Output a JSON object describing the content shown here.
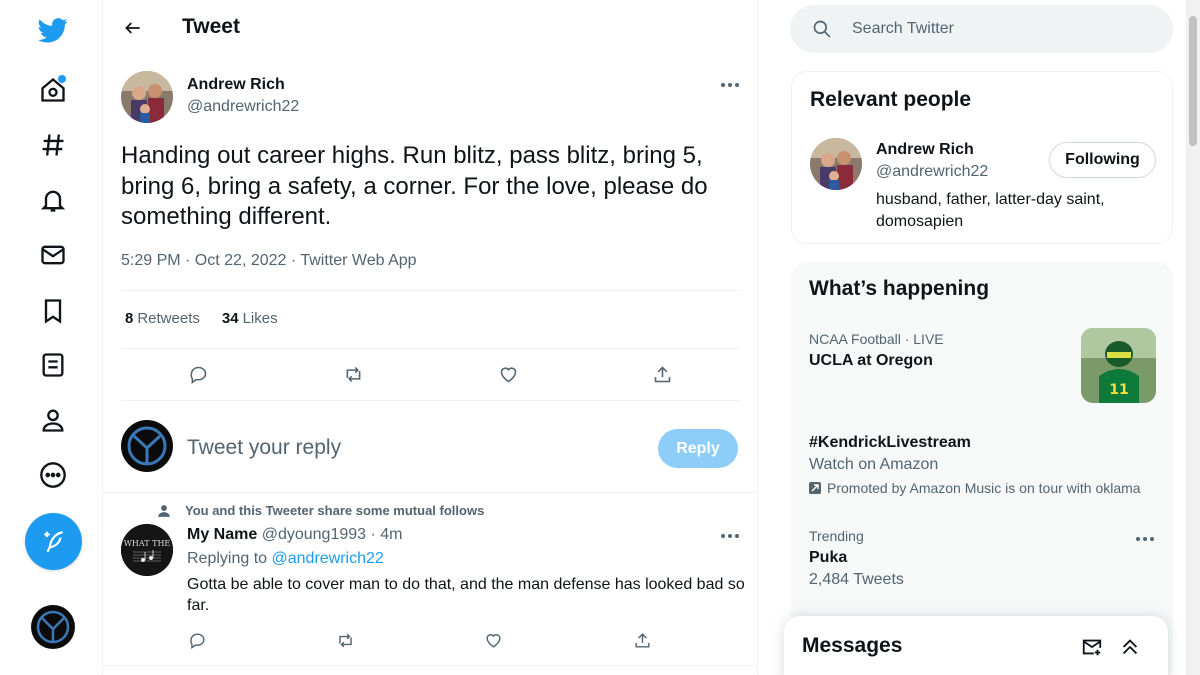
{
  "header": {
    "title": "Tweet"
  },
  "tweet": {
    "author_name": "Andrew Rich",
    "author_handle": "@andrewrich22",
    "text": "Handing out career highs. Run blitz, pass blitz, bring 5, bring 6, bring a safety, a corner. For the love, please do something different.",
    "meta": "5:29 PM · Oct 22, 2022 · Twitter Web App",
    "retweets_count": "8",
    "retweets_label": "Retweets",
    "likes_count": "34",
    "likes_label": "Likes"
  },
  "reply_box": {
    "placeholder": "Tweet your reply",
    "button_label": "Reply"
  },
  "reply": {
    "social_context": "You and this Tweeter share some mutual follows",
    "name": "My Name",
    "handle": "@dyoung1993",
    "time": "· 4m",
    "replying_prefix": "Replying to",
    "replying_to": "@andrewrich22",
    "text": "Gotta be able to cover man to do that, and the man defense has looked bad so far.",
    "avatar_text": "WHAT THE"
  },
  "search": {
    "placeholder": "Search Twitter"
  },
  "relevant_people": {
    "title": "Relevant people",
    "name": "Andrew Rich",
    "handle": "@andrewrich22",
    "bio": "husband, father, latter-day saint, domosapien",
    "button": "Following"
  },
  "whats_happening": {
    "title": "What’s happening",
    "trends": [
      {
        "category": "NCAA Football · LIVE",
        "title": "UCLA at Oregon"
      },
      {
        "title": "#KendrickLivestream",
        "subtitle": "Watch on Amazon",
        "promo": "Promoted by Amazon Music is on tour with oklama"
      },
      {
        "category": "Trending",
        "title": "Puka",
        "count": "2,484 Tweets"
      }
    ]
  },
  "messages": {
    "title": "Messages"
  },
  "colors": {
    "accent": "#1d9bf0",
    "reply_disabled": "#8ecdf8",
    "text": "#0f1419",
    "muted": "#536471"
  }
}
